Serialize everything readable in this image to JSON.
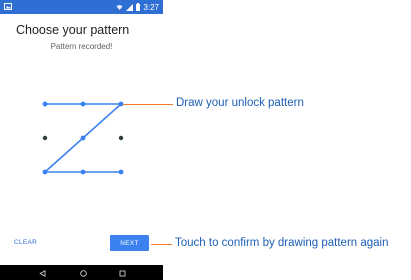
{
  "status_bar": {
    "time": "3:27"
  },
  "screen": {
    "title": "Choose your pattern",
    "subtitle": "Pattern recorded!"
  },
  "buttons": {
    "clear": "CLEAR",
    "next": "NEXT"
  },
  "callouts": {
    "pattern": "Draw your unlock pattern",
    "confirm": "Touch to confirm by drawing pattern again"
  },
  "colors": {
    "status_bar": "#2f6fd3",
    "accent": "#3b82f0",
    "callout_line": "#f07a2a",
    "callout_text": "#1d5fb5",
    "inactive_dot": "#2e3b3b"
  },
  "icons": {
    "status_left": "image-icon",
    "status_right": [
      "wifi-icon",
      "signal-icon",
      "battery-icon"
    ],
    "nav": [
      "back-icon",
      "home-icon",
      "recents-icon"
    ]
  }
}
